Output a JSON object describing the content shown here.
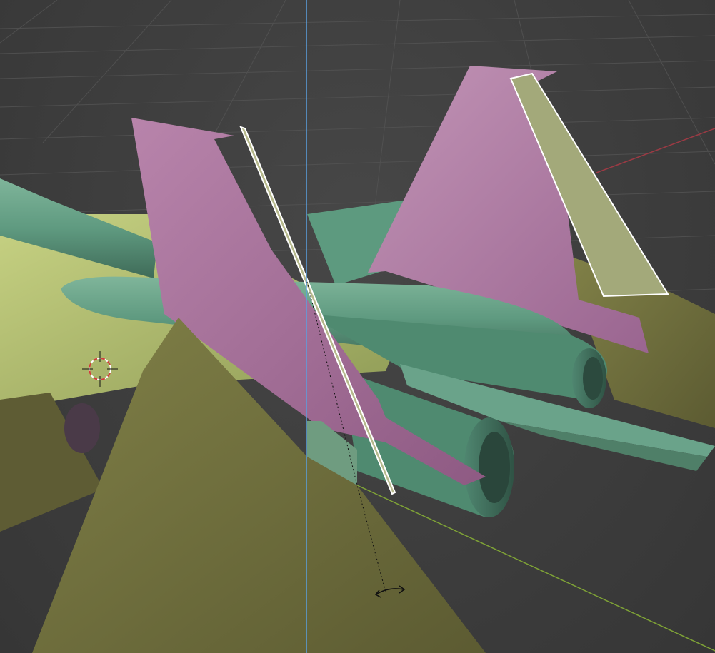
{
  "app": "3D viewport",
  "viewport": {
    "mode": "object-rotate",
    "background_color": "#3d3d3d",
    "grid_color": "#555555",
    "x_axis_color": "#9c3a44",
    "y_axis_color": "#7fa336",
    "z_axis_color": "#5aa0e0",
    "selection_outline_color": "#ffffff"
  },
  "scene": {
    "object": "fighter-jet-model",
    "material_colors": {
      "fuselage_green": "#5f9a80",
      "wing_yellow": "#aab86a",
      "tail_pink": "#a8709a",
      "selected_rudder": "#a3a97a",
      "ventral_olive": "#6b6a3c"
    }
  },
  "cursor": {
    "icon": "rotate-arrows-icon"
  },
  "cursor_3d": {
    "icon": "3d-cursor-crosshair-icon"
  }
}
